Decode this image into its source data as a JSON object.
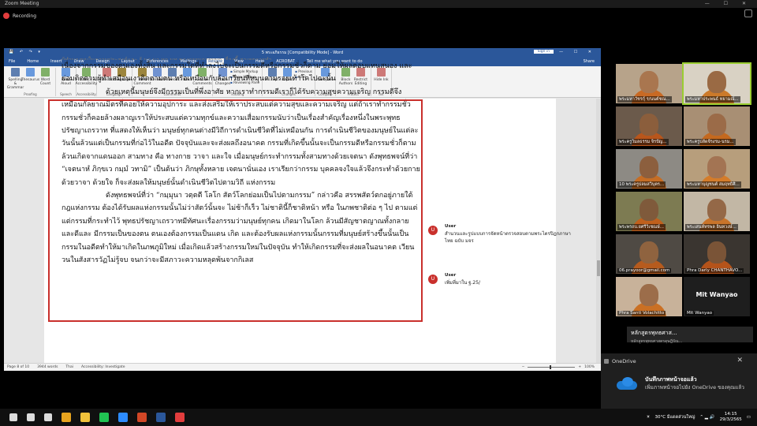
{
  "zoom": {
    "window_title": "Zoom Meeting",
    "recording_label": "Recording",
    "window_controls": "—  ☐  ✕"
  },
  "word": {
    "doc_title": "5 พระอภิธรรม [Compatibility Mode] - Word",
    "quick_access": "💾 ↶ ↷ ▾",
    "sign_in": "Sign in",
    "window_controls": "▢ — ☐ ✕",
    "tabs": [
      "File",
      "Home",
      "Insert",
      "Draw",
      "Design",
      "Layout",
      "References",
      "Mailings",
      "Review",
      "View",
      "Help",
      "ACROBAT",
      "Tell me what you want to do"
    ],
    "active_tab": "Review",
    "share_label": "Share",
    "ribbon": {
      "proofing": {
        "label": "Proofing",
        "buttons": [
          "Spelling & Grammar",
          "Thesaurus",
          "Word Count"
        ]
      },
      "speech": {
        "label": "Speech",
        "buttons": [
          "Read Aloud"
        ]
      },
      "accessibility": {
        "label": "Accessibility",
        "buttons": [
          "Check Accessibility"
        ]
      },
      "language": {
        "label": "Language",
        "buttons": [
          "Translate",
          "Language"
        ]
      },
      "comments": {
        "label": "Comments",
        "buttons": [
          "New Comment",
          "Delete",
          "Previous",
          "Next",
          "Show Comments"
        ]
      },
      "tracking": {
        "label": "Tracking",
        "buttons": [
          "Track Changes"
        ],
        "small": [
          "Simple Markup",
          "Show Markup",
          "Reviewing Pane"
        ]
      },
      "changes": {
        "label": "Changes",
        "buttons": [
          "Accept",
          "Reject"
        ],
        "small": [
          "Previous",
          "Next"
        ]
      },
      "compare": {
        "label": "Compare",
        "buttons": [
          "Compare"
        ]
      },
      "protect": {
        "label": "Protect",
        "buttons": [
          "Block Authors",
          "Restrict Editing"
        ]
      },
      "ink": {
        "label": "Ink",
        "buttons": [
          "Hide Ink"
        ]
      }
    },
    "status": {
      "page": "Page 8 of 10",
      "words": "3944 words",
      "language": "Thai",
      "accessibility": "Accessibility: Investigate",
      "zoom": "100%"
    }
  },
  "document": {
    "top_faded": "ผู้ทำนองบบในความประสงค์และ รู้ นา นา หก นท ของกรรมการนบก เรื่องนี้ สาเหตุการทำ",
    "paragraphs": [
      {
        "indent": false,
        "text": "เนื่องจากกรรมของตนเองทั้งสิ้น และกรรมใดที่ทำลงไปจะเป็นกรรมดีหรือกรรมชั่วก็ตาม ย่อมให้ผลตอบแทนสนอง และย่อมติดตามผู้ทำเสมือนเงาติดตามตน หรือเหมือนกับล้อเกวียนที่หมุนตามรอยเท้าโคไปฉะนั้น"
      },
      {
        "indent": true,
        "text": "ด้วยเหตุนี้มนุษย์จึงมีกรรมเป็นที่พึ่งอาศัย หากเราทำกรรมดีเราก็ได้รับความสุขความเจริญ กรรมดีจึงเหมือนกัลยาณมิตรที่คอยให้ความอุปการะ และส่งเสริมให้เราประสบแต่ความสุขและความเจริญ แต่ถ้าเราทำกรรมชั่ว กรรมชั่วก็คอยล้างผลาญเราให้ประสบแต่ความทุกข์และความเสื่อมกรรมนับว่าเป็นเรื่องสำคัญเรื่องหนึ่งในพระพุทธปรัชญาเถรวาท ที่แสดงให้เห็นว่า มนุษย์ทุกคนต่างมีวิถีการดำเนินชีวิตที่ไม่เหมือนกัน การดำเนินชีวิตของมนุษย์ในแต่ละวันนั้นล้วนแต่เป็นกรรมที่ก่อไว้ในอดีต ปัจจุบันและจะส่งผลถึงอนาคต กรรมที่เกิดขึ้นนั้นจะเป็นกรรมดีหรือกรรมชั่วก็ตามล้วนเกิดจากแดนออก สามทาง คือ ทางกาย วาจา และใจ เมื่อมนุษย์กระทำกรรมทั้งสามทางด้วยเจตนา ดังพุทธพจน์ที่ว่า “เจตนาหํ ภิกฺขเว กมฺมํ วทามิ” เป็นต้นว่า ภิกษุทั้งหลาย เจตนานั่นเอง เราเรียกว่ากรรม บุคคลจงใจแล้วจึงกระทำด้วยกาย ด้วยวาจา ด้วยใจ ก็จะส่งผลให้มนุษย์นั้นดำเนินชีวิตไปตามวิถี แห่งกรรม"
      },
      {
        "indent": true,
        "text": "ดังพุทธพจน์ที่ว่า “กมฺมุนา วตฺตตี โลโก สัตว์โลกย่อมเป็นไปตามกรรม” กล่าวคือ สรรพสัตว์ตกอยู่ภายใต้กฎแห่งกรรม ต้องได้รับผลแห่งกรรมนั้นไม่ว่าสัตว์นั้นจะ ไม่ช้าก็เร็ว ไม่ชาตินี้ก็ชาติหน้า หรือ ในภพชาติต่อ ๆ ไป ตามแต่แต่กรรมที่กระทำไว้ พุทธปรัชญาเถรวาทมีทัศนะเรื่องกรรมว่ามนุษย์ทุกคน เกิดมาในโลก ล้วนมีสัญชาตญาณทั้งกลายและดีและ มีกรรมเป็นของตน ตนเองต้องกรรมเป็นแดน เกิด และต้องรับผลแห่งกรรมนั้นกรรมที่มนุษย์สร้างขึ้นนั้นเป็น กรรมในอดีตทำให้มาเกิดในภพภูมิใหม่ เมื่อเกิดแล้วสร้างกรรมใหม่ในปัจจุบัน ทำให้เกิดกรรมที่จะส่งผลในอนาคต เวียนวนในสังสารวัฏไม่รู้จบ จนกว่าจะมีสภาวะความหลุดพ้นจากกิเลส"
      }
    ]
  },
  "comments": [
    {
      "initial": "U",
      "user": "User",
      "text": "สำนวนและรูปแบบการจัดหน้าตรวจสอบตามพระไตรปิฎกภาษาไทย ฉบับ มจร"
    },
    {
      "initial": "U",
      "user": "User",
      "text": "เพิ่มที่มาใน ฐ.25/"
    }
  ],
  "gallery": [
    {
      "name": "พระมหาวัชรกุ์ ร/นนต์ชณ...",
      "talking": false,
      "bg": "#b7a38a",
      "skin": "#a9764f",
      "robe": "#c96a24"
    },
    {
      "name": "พระมหาประพนธ์ ทยามณ์...",
      "talking": true,
      "bg": "#d9d2c4",
      "skin": "#9a6a44",
      "robe": "#cc7a2a"
    },
    {
      "name": "พระครูวิมลธรรม จิรปัญ...",
      "talking": false,
      "bg": "#6b5a4b",
      "skin": "#8b5e3c",
      "robe": "#b8561c"
    },
    {
      "name": "พระครูปลัดจีรงรม-นรม...",
      "talking": false,
      "bg": "#a88f74",
      "skin": "#9b6b48",
      "robe": "#c4691f"
    },
    {
      "name": "10 พระครูปลมสวิบุตร...",
      "talking": false,
      "bg": "#8d8a84",
      "skin": "#8c5f3e",
      "robe": "#c56d24"
    },
    {
      "name": "พระมหาบุญชนต์ สมฤทธิศิ...",
      "talking": false,
      "bg": "#b79e7c",
      "skin": "#a37453",
      "robe": "#d47c2a"
    },
    {
      "name": "พระพรถบ.ยศรีวิเชณษ์...",
      "talking": false,
      "bg": "#7d7b52",
      "skin": "#7f5a3b",
      "robe": "#c0601d"
    },
    {
      "name": "พระเสนห์ทรพล อินทวงษ์...",
      "talking": false,
      "bg": "#c2b7a5",
      "skin": "#946847",
      "robe": "#c8742a"
    },
    {
      "name": "06.prayoor@gmail.com",
      "talking": false,
      "bg": "#4f4a44",
      "skin": "#8f633f",
      "robe": "#b65b1e"
    },
    {
      "name": "Phra Darly CHANTHAVO...",
      "talking": false,
      "bg": "#3a3530",
      "skin": "#7a5437",
      "robe": "#b5531a"
    },
    {
      "name": "Phra Santi Volachitto",
      "talking": false,
      "bg": "#c8b29a",
      "skin": "#9c6d4a",
      "robe": "#ca7024"
    },
    {
      "name": "Mit Wanyao",
      "talking": false,
      "blank": true,
      "bigname": "Mit Wanyao"
    }
  ],
  "share_banner": {
    "title": "หลักสูตรพุทธศาส...",
    "sub": "หลักสูตรพุทธศาสตรดุษฎีบัณ..."
  },
  "toast": {
    "app": "OneDrive",
    "close": "✕",
    "title": "บันทึกภาพหน้าจอแล้ว",
    "body": "เพิ่มภาพหน้าจอไปยัง OneDrive ของคุณแล้ว"
  },
  "taskbar": {
    "apps": [
      {
        "name": "windows-start-icon",
        "color": "#ffffff"
      },
      {
        "name": "search-icon",
        "color": "#ffffff"
      },
      {
        "name": "task-view-icon",
        "color": "#ffffff"
      },
      {
        "name": "chrome-icon",
        "color": "#e8a41f"
      },
      {
        "name": "file-explorer-icon",
        "color": "#f0c23b"
      },
      {
        "name": "line-icon",
        "color": "#21c353"
      },
      {
        "name": "zoom-icon",
        "color": "#2d8cff"
      },
      {
        "name": "powerpoint-icon",
        "color": "#d24726"
      },
      {
        "name": "word-icon",
        "color": "#2b579a"
      },
      {
        "name": "pdf-icon",
        "color": "#e23d3d"
      }
    ],
    "weather": "30°C มีแดดส่วนใหญ่",
    "time": "14:15",
    "date": "29/3/2565"
  }
}
